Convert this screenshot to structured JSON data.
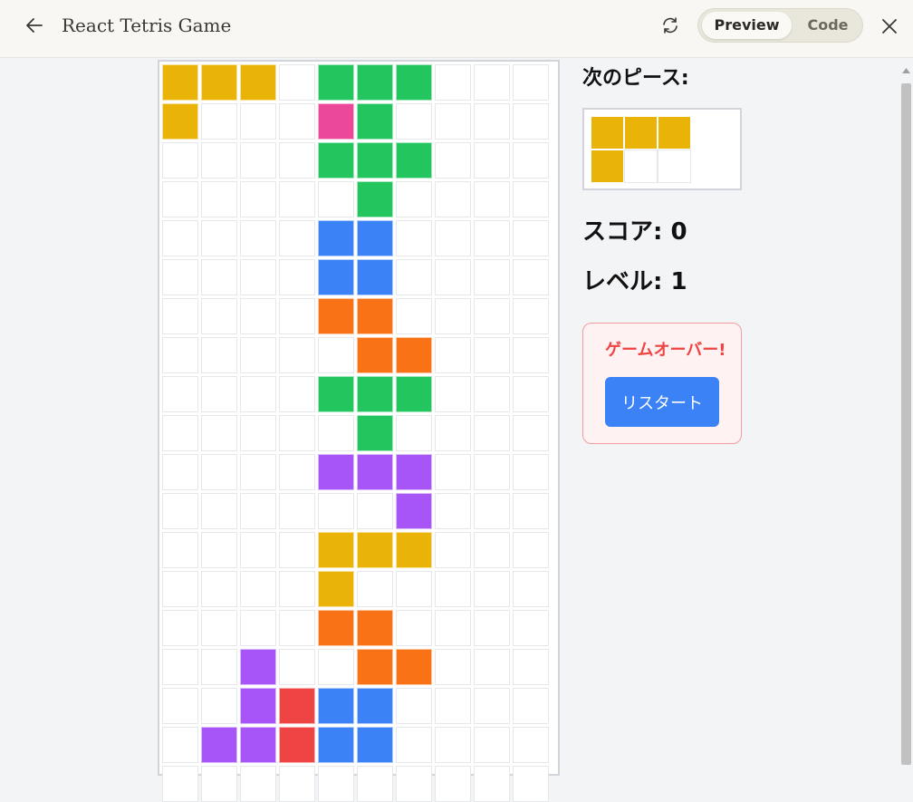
{
  "header": {
    "title": "React Tetris Game",
    "tabs": [
      {
        "label": "Preview",
        "active": true
      },
      {
        "label": "Code",
        "active": false
      }
    ],
    "icons": {
      "back": "arrow-left-icon",
      "refresh": "refresh-icon",
      "close": "close-icon"
    }
  },
  "game": {
    "colors": {
      "Y": "#eab308",
      "G": "#22c55e",
      "P": "#ec4899",
      "B": "#3b82f6",
      "O": "#f97316",
      "V": "#a855f7",
      "R": "#ef4444"
    },
    "board": [
      "YYY.GGG...",
      "Y...PG....",
      "....GGG...",
      ".....G....",
      "....BB....",
      "....BB....",
      "....OO....",
      ".....OO...",
      "....GGG...",
      ".....G....",
      "....VVV...",
      "......V...",
      "....YYY...",
      "....Y.....",
      "....OO....",
      "..V..OO...",
      "..VRBB....",
      ".VVRBB....",
      ".........."
    ],
    "next_label": "次のピース:",
    "next_piece": [
      "YYY",
      "Y.."
    ],
    "score_text": "スコア: 0",
    "level_text": "レベル: 1",
    "game_over_text": "ゲームオーバー!",
    "restart_label": "リスタート"
  }
}
